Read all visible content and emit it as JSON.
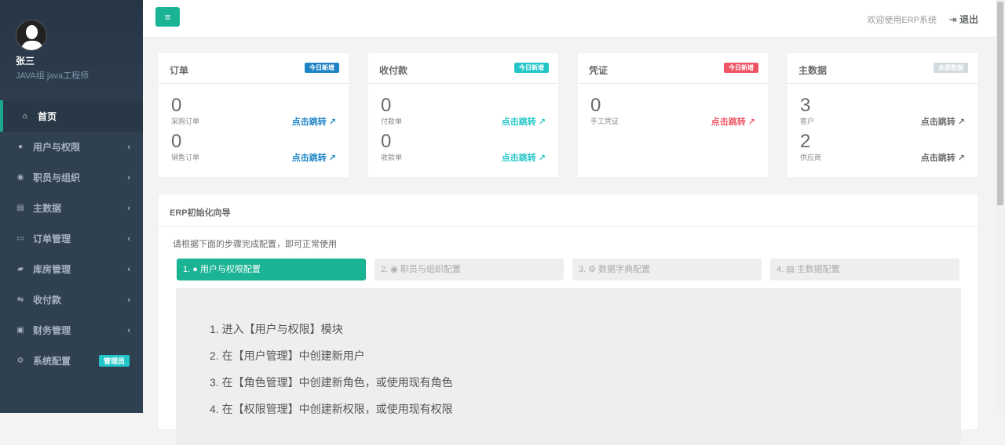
{
  "user": {
    "name": "张三",
    "role": "JAVA组 java工程师"
  },
  "nav": [
    {
      "icon": "home-icon",
      "glyph": "⌂",
      "label": "首页",
      "active": true
    },
    {
      "icon": "user-shield-icon",
      "glyph": "●",
      "label": "用户与权限"
    },
    {
      "icon": "user-circle-icon",
      "glyph": "◉",
      "label": "职员与组织"
    },
    {
      "icon": "database-icon",
      "glyph": "▤",
      "label": "主数据"
    },
    {
      "icon": "order-icon",
      "glyph": "▭",
      "label": "订单管理"
    },
    {
      "icon": "truck-icon",
      "glyph": "▰",
      "label": "库房管理"
    },
    {
      "icon": "handshake-icon",
      "glyph": "⇋",
      "label": "收付款"
    },
    {
      "icon": "money-icon",
      "glyph": "▣",
      "label": "财务管理"
    },
    {
      "icon": "gear-icon",
      "glyph": "⚙",
      "label": "系统配置",
      "badge": "管理员"
    }
  ],
  "topbar": {
    "menu_icon": "≡",
    "welcome": "欢迎使用ERP系统",
    "logout": "退出"
  },
  "cards": [
    {
      "title": "订单",
      "label": "今日新增",
      "label_color": "#1c84c6",
      "link_color": "#1c84c6",
      "rows": [
        {
          "value": "0",
          "name": "采购订单",
          "link": "点击跳转"
        },
        {
          "value": "0",
          "name": "销售订单",
          "link": "点击跳转"
        }
      ]
    },
    {
      "title": "收付款",
      "label": "今日新增",
      "label_color": "#23c6c8",
      "link_color": "#23c6c8",
      "rows": [
        {
          "value": "0",
          "name": "付款单",
          "link": "点击跳转"
        },
        {
          "value": "0",
          "name": "收款单",
          "link": "点击跳转"
        }
      ]
    },
    {
      "title": "凭证",
      "label": "今日新增",
      "label_color": "#ed5565",
      "link_color": "#ed5565",
      "rows": [
        {
          "value": "0",
          "name": "手工凭证",
          "link": "点击跳转"
        }
      ]
    },
    {
      "title": "主数据",
      "label": "全部数据",
      "label_color": "#d1dade",
      "link_color": "#676a6c",
      "rows": [
        {
          "value": "3",
          "name": "客户",
          "link": "点击跳转"
        },
        {
          "value": "2",
          "name": "供应商",
          "link": "点击跳转"
        }
      ]
    }
  ],
  "wizard": {
    "title": "ERP初始化向导",
    "tip": "请根据下面的步骤完成配置，即可正常使用",
    "steps": [
      "1. ● 用户与权限配置",
      "2. ◉ 职员与组织配置",
      "3. ⚙ 数据字典配置",
      "4. ▤ 主数据配置"
    ],
    "instructions": [
      "1. 进入【用户与权限】模块",
      "2. 在【用户管理】中创建新用户",
      "3. 在【角色管理】中创建新角色，或使用现有角色",
      "4. 在【权限管理】中创建新权限，或使用现有权限"
    ]
  }
}
